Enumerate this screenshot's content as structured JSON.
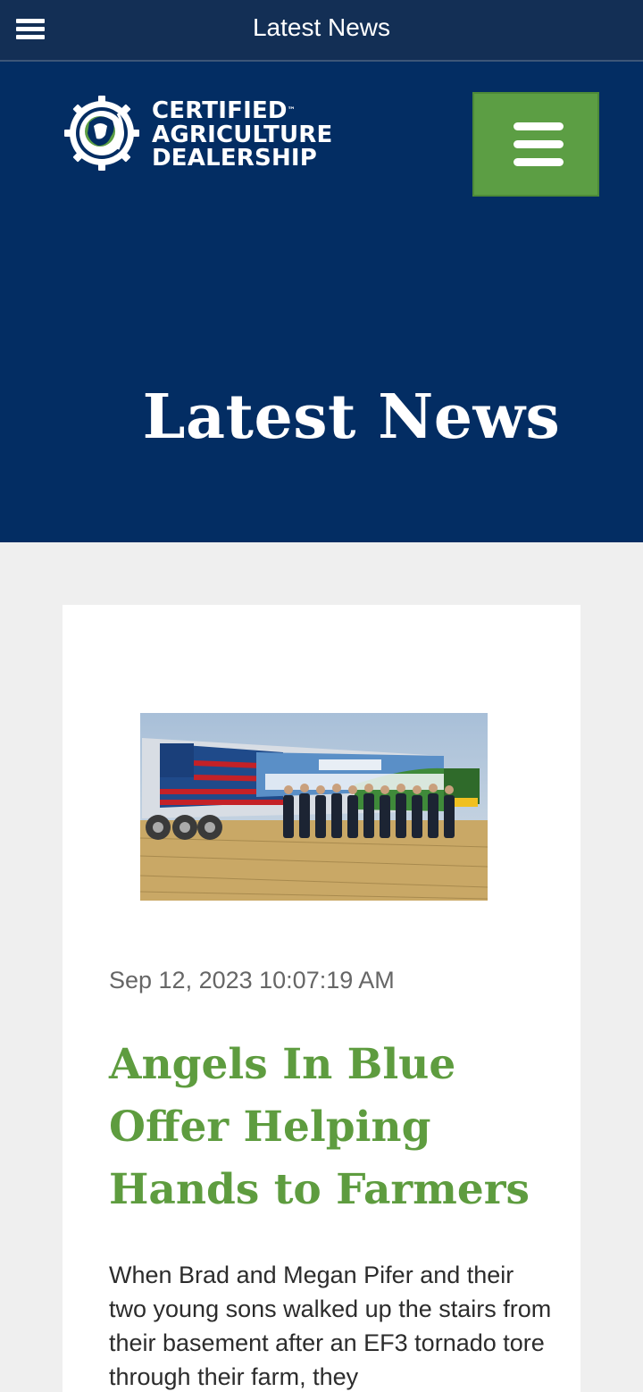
{
  "app_bar": {
    "title": "Latest News",
    "menu_icon": "hamburger-icon"
  },
  "brand": {
    "logo_icon": "lion-gear-emblem-icon",
    "logo_lines": [
      "CERTIFIED",
      "AGRICULTURE",
      "DEALERSHIP"
    ],
    "trademark": "™",
    "colors": {
      "navy": "#032d63",
      "green": "#5c9e44"
    }
  },
  "nav": {
    "toggle_icon": "hamburger-icon"
  },
  "hero": {
    "title": "Latest News"
  },
  "article": {
    "image_icon": "farm-rescue-trailer-photo",
    "date": "Sep 12, 2023 10:07:19 AM",
    "headline": "Angels In Blue Offer Helping Hands to Farmers",
    "excerpt": "When Brad and Megan Pifer and their two young sons walked up the stairs from their basement after an EF3 tornado tore through their farm, they"
  }
}
